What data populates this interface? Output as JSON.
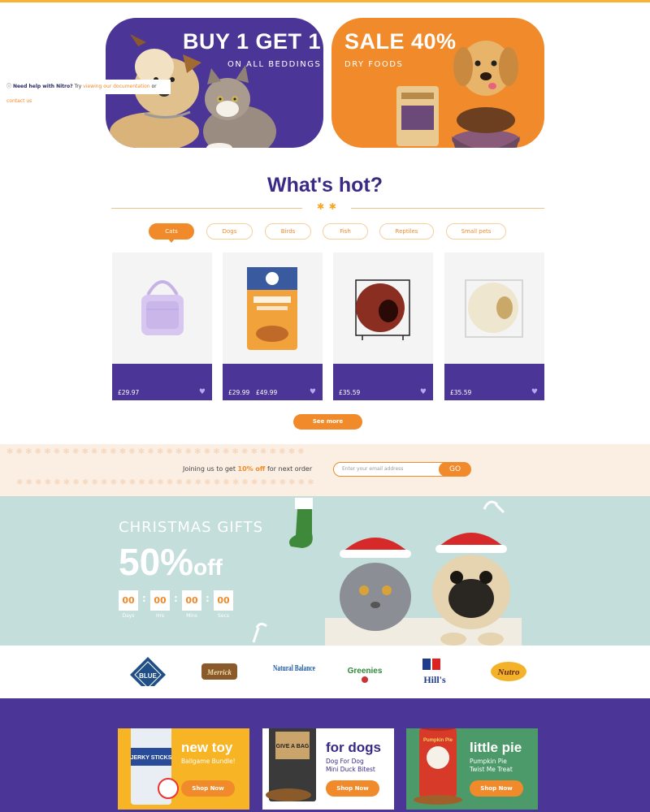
{
  "promos": {
    "left": {
      "title": "BUY 1 GET 1",
      "subtitle": "ON ALL BEDDINGS"
    },
    "right": {
      "title": "SALE 40%",
      "subtitle": "DRY FOODS"
    }
  },
  "help": {
    "icon": "info-icon",
    "label": "Need help with Nitro?",
    "try": "Try",
    "doc_link": "viewing our documentation",
    "or": "or",
    "contact_link": "contact us"
  },
  "hot": {
    "title": "What's hot?",
    "tabs": [
      {
        "label": "Cats",
        "active": true
      },
      {
        "label": "Dogs"
      },
      {
        "label": "Birds"
      },
      {
        "label": "Fish"
      },
      {
        "label": "Reptiles"
      },
      {
        "label": "Small pets"
      }
    ],
    "products": [
      {
        "price": "£29.97",
        "icon": "heart-icon"
      },
      {
        "price": "£29.99",
        "price2": "£49.99",
        "icon": "heart-icon"
      },
      {
        "price": "£35.59",
        "icon": "heart-icon"
      },
      {
        "price": "£35.59",
        "icon": "heart-icon"
      }
    ],
    "see_more": "See more"
  },
  "newsletter": {
    "text_before": "Joining us to get ",
    "highlight": "10% off",
    "text_after": " for next order",
    "placeholder": "Enter your email address",
    "go": "GO"
  },
  "christmas": {
    "title": "CHRISTMAS GIFTS",
    "percent": "50%",
    "off": "off",
    "countdown": [
      {
        "value": "00",
        "label": "Days"
      },
      {
        "value": "00",
        "label": "Hrs"
      },
      {
        "value": "00",
        "label": "Mins"
      },
      {
        "value": "00",
        "label": "Secs"
      }
    ],
    "separator": ":"
  },
  "brands": [
    "BLUE",
    "Merrick",
    "Natural Balance",
    "Greenies",
    "Hill's",
    "Nutro"
  ],
  "bottom": [
    {
      "title": "new toy",
      "subtitle": "Ballgame Bundle!",
      "button": "Shop Now",
      "pack_label": "JERKY STICKS"
    },
    {
      "title": "for dogs",
      "subtitle_line1": "Dog For Dog",
      "subtitle_line2": "Mini Duck Bitest",
      "button": "Shop Now",
      "pack_label": "GIVE A BAG"
    },
    {
      "title": "little pie",
      "subtitle_line1": "Pumpkin Pie",
      "subtitle_line2": "Twist Me Treat",
      "button": "Shop Now",
      "pack_label": "Pumpkin Pie"
    }
  ],
  "colors": {
    "purple": "#4b3596",
    "orange": "#f18a2a",
    "mint": "#c4dedb",
    "cream": "#fbefe3"
  }
}
